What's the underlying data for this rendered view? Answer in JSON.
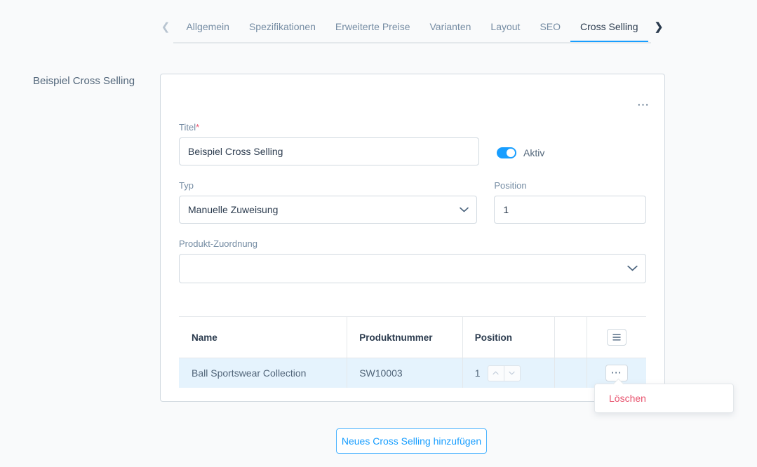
{
  "tabs": {
    "prev_icon": "chevron-left-icon",
    "next_icon": "chevron-right-icon",
    "items": [
      {
        "label": "Allgemein",
        "active": false
      },
      {
        "label": "Spezifikationen",
        "active": false
      },
      {
        "label": "Erweiterte Preise",
        "active": false
      },
      {
        "label": "Varianten",
        "active": false
      },
      {
        "label": "Layout",
        "active": false
      },
      {
        "label": "SEO",
        "active": false
      },
      {
        "label": "Cross Selling",
        "active": true
      }
    ]
  },
  "section": {
    "label": "Beispiel Cross Selling"
  },
  "card": {
    "menu_icon": "ellipsis-icon",
    "title_field": {
      "label": "Titel",
      "required_marker": "*",
      "value": "Beispiel Cross Selling",
      "placeholder": ""
    },
    "active_toggle": {
      "label": "Aktiv",
      "state": "on"
    },
    "type_field": {
      "label": "Typ",
      "value": "Manuelle Zuweisung",
      "options": [
        "Manuelle Zuweisung"
      ],
      "chevron_icon": "chevron-down-icon"
    },
    "position_field": {
      "label": "Position",
      "value": "1",
      "placeholder": ""
    },
    "product_assignment_field": {
      "label": "Produkt-Zuordnung",
      "value": "",
      "placeholder": "",
      "chevron_icon": "chevron-down-icon"
    }
  },
  "table": {
    "columns": [
      {
        "key": "name",
        "header": "Name"
      },
      {
        "key": "number",
        "header": "Produktnummer"
      },
      {
        "key": "position",
        "header": "Position"
      },
      {
        "key": "spacer",
        "header": ""
      },
      {
        "key": "actions",
        "header": ""
      }
    ],
    "settings_icon": "table-settings-icon",
    "rows": [
      {
        "name": "Ball Sportswear Collection",
        "number": "SW10003",
        "position": "1",
        "position_up_icon": "chevron-up-icon",
        "position_down_icon": "chevron-down-icon",
        "actions_icon": "ellipsis-icon",
        "selected": true
      }
    ]
  },
  "context_menu": {
    "items": [
      {
        "label": "Löschen",
        "variant": "danger"
      }
    ]
  },
  "footer": {
    "add_button_label": "Neues Cross Selling hinzufügen"
  },
  "colors": {
    "accent": "#189eff",
    "danger": "#e8546f",
    "page_bg": "#f9fafb",
    "row_selected_bg": "#e5f3fd",
    "border": "#d1d9e0",
    "text": "#52667a"
  }
}
